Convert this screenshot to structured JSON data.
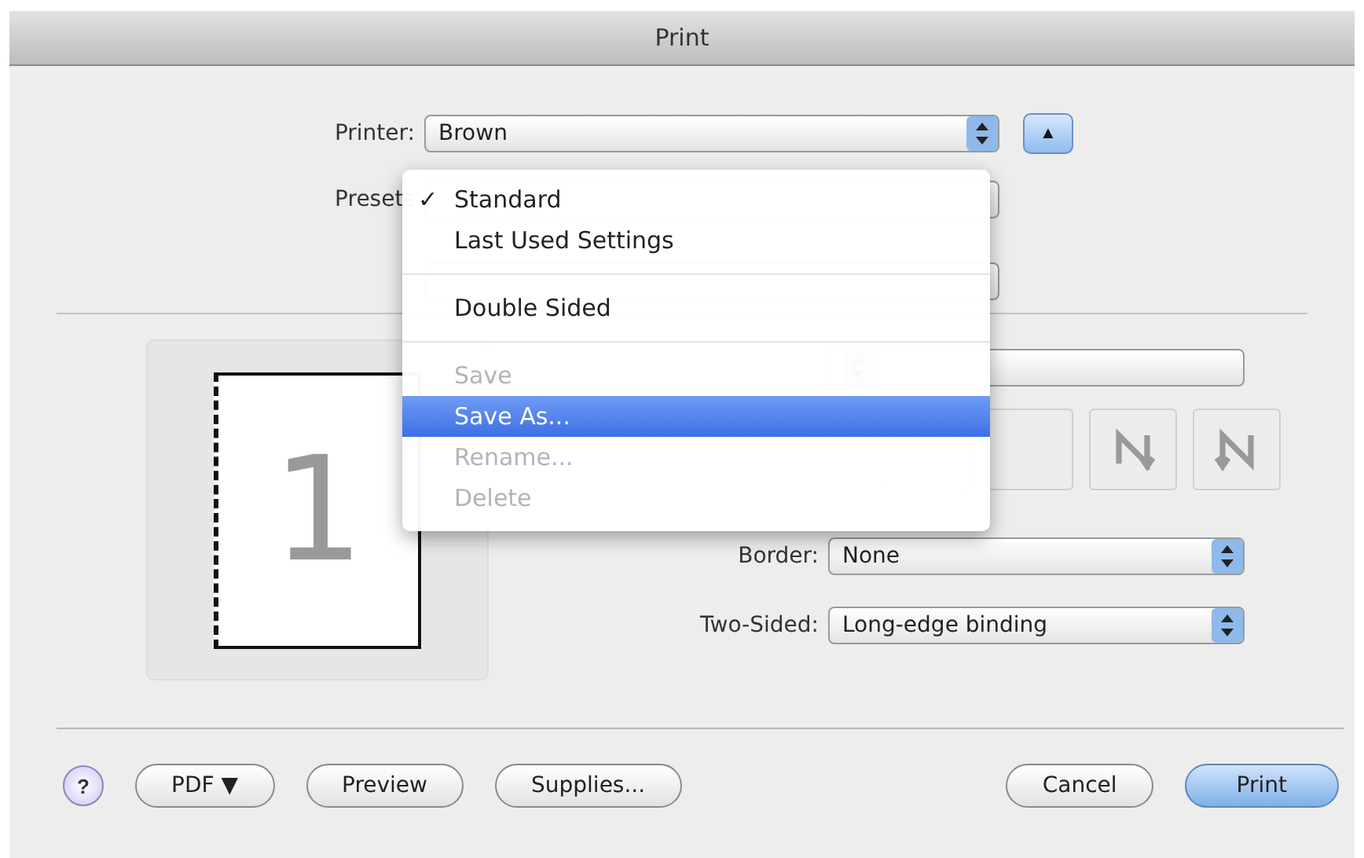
{
  "window": {
    "title": "Print"
  },
  "printer": {
    "label": "Printer:",
    "value": "Brown",
    "disclosure": "▲"
  },
  "presets": {
    "label": "Presets"
  },
  "presets_menu": {
    "check_glyph": "✓",
    "items": [
      {
        "kind": "item",
        "label": "Standard",
        "checked": true,
        "disabled": false,
        "selected": false
      },
      {
        "kind": "item",
        "label": "Last Used Settings",
        "checked": false,
        "disabled": false,
        "selected": false
      },
      {
        "kind": "separator"
      },
      {
        "kind": "item",
        "label": "Double Sided",
        "checked": false,
        "disabled": false,
        "selected": false
      },
      {
        "kind": "separator"
      },
      {
        "kind": "item",
        "label": "Save",
        "checked": false,
        "disabled": true,
        "selected": false
      },
      {
        "kind": "item",
        "label": "Save As...",
        "checked": false,
        "disabled": false,
        "selected": true
      },
      {
        "kind": "item",
        "label": "Rename...",
        "checked": false,
        "disabled": true,
        "selected": false
      },
      {
        "kind": "item",
        "label": "Delete",
        "checked": false,
        "disabled": true,
        "selected": false
      }
    ]
  },
  "preview": {
    "page_number": "1"
  },
  "border": {
    "label": "Border:",
    "value": "None"
  },
  "two_sided": {
    "label": "Two-Sided:",
    "value": "Long-edge binding"
  },
  "buttons": [
    {
      "kind": "help",
      "label": "?"
    },
    {
      "kind": "push",
      "label": "PDF ▼"
    },
    {
      "kind": "push",
      "label": "Preview"
    },
    {
      "kind": "push",
      "label": "Supplies..."
    },
    {
      "kind": "spacer"
    },
    {
      "kind": "push",
      "label": "Cancel"
    },
    {
      "kind": "default",
      "label": "Print"
    }
  ]
}
